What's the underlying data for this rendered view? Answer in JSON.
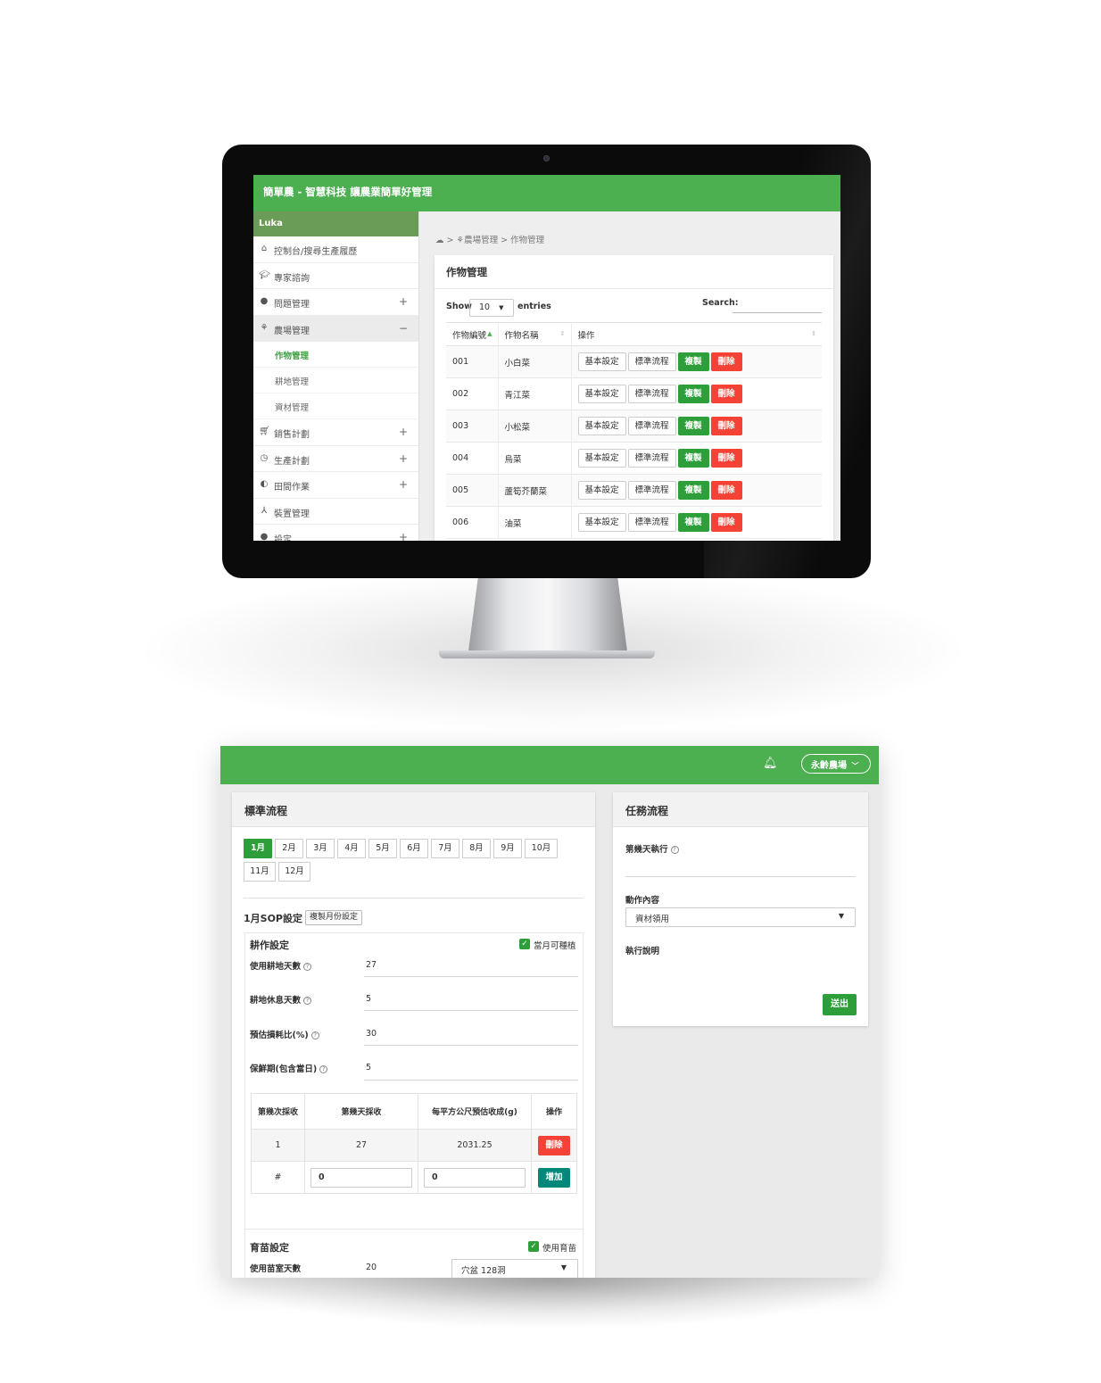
{
  "desktop": {
    "app_title": "簡單農 - 智慧科技 讓農業簡單好管理",
    "user": "Luka",
    "sidebar": [
      {
        "label": "控制台/搜尋生產履歷",
        "icon": "home-icon",
        "toggle": ""
      },
      {
        "label": "專家諮詢",
        "icon": "graduation-cap-icon",
        "toggle": ""
      },
      {
        "label": "問題管理",
        "icon": "alert-circle-icon",
        "toggle": "+"
      },
      {
        "label": "農場管理",
        "icon": "farm-icon",
        "toggle": "−",
        "active": true
      },
      {
        "label": "銷售計劃",
        "icon": "cart-icon",
        "toggle": "+"
      },
      {
        "label": "生產計劃",
        "icon": "clock-icon",
        "toggle": "+"
      },
      {
        "label": "田間作業",
        "icon": "field-work-icon",
        "toggle": "+"
      },
      {
        "label": "裝置管理",
        "icon": "device-network-icon",
        "toggle": ""
      },
      {
        "label": "設定",
        "icon": "settings-icon",
        "toggle": "+"
      }
    ],
    "submenu": [
      "作物管理",
      "耕地管理",
      "資材管理"
    ],
    "breadcrumb": {
      "parent": "農場管理",
      "separator": ">",
      "current": "作物管理"
    },
    "card_title": "作物管理",
    "table_controls": {
      "show": "Show",
      "page_size": "10",
      "entries": "entries",
      "search": "Search:"
    },
    "columns": [
      "作物編號",
      "作物名稱",
      "操作"
    ],
    "rows": [
      {
        "id": "001",
        "name": "小白菜"
      },
      {
        "id": "002",
        "name": "青江菜"
      },
      {
        "id": "003",
        "name": "小松菜"
      },
      {
        "id": "004",
        "name": "烏菜"
      },
      {
        "id": "005",
        "name": "蘆筍芥蘭菜"
      },
      {
        "id": "006",
        "name": "油菜"
      }
    ],
    "row_buttons": {
      "basic": "基本設定",
      "sop": "標準流程",
      "copy": "複製",
      "delete": "刪除"
    }
  },
  "panel": {
    "farm_selector": "永齡農場",
    "sop_card": {
      "title": "標準流程",
      "months": [
        "1月",
        "2月",
        "3月",
        "4月",
        "5月",
        "6月",
        "7月",
        "8月",
        "9月",
        "10月",
        "11月",
        "12月"
      ],
      "selected_month": "1月",
      "sop_heading": "1月SOP設定",
      "copy_month_button": "複製月份設定",
      "cultivation": {
        "title": "耕作設定",
        "plantable_label": "當月可種植",
        "plantable_checked": true,
        "fields": [
          {
            "label": "使用耕地天數",
            "value": "27"
          },
          {
            "label": "耕地休息天數",
            "value": "5"
          },
          {
            "label": "預估損耗比(%)",
            "value": "30"
          },
          {
            "label": "保鮮期(包含當日)",
            "value": "5"
          }
        ]
      },
      "harvest_table": {
        "headers": [
          "第幾次採收",
          "第幾天採收",
          "每平方公尺預估收成(g)",
          "操作"
        ],
        "rows": [
          {
            "n": "1",
            "day": "27",
            "yield": "2031.25",
            "action": "刪除"
          }
        ],
        "new_row": {
          "n": "#",
          "day": "0",
          "yield": "0",
          "action": "增加"
        }
      },
      "seedling": {
        "title": "育苗設定",
        "use_label": "使用育苗",
        "use_checked": true,
        "days_label": "使用苗室天數",
        "days_value": "20",
        "tray": "穴盆 128洞"
      }
    },
    "task_card": {
      "title": "任務流程",
      "day_label": "第幾天執行",
      "action_label": "動作內容",
      "action_value": "資材領用",
      "desc_label": "執行說明",
      "submit": "送出"
    }
  },
  "colors": {
    "brand_green": "#4caf50",
    "button_green": "#2e9e3a",
    "danger": "#f44336",
    "teal": "#00897b"
  }
}
